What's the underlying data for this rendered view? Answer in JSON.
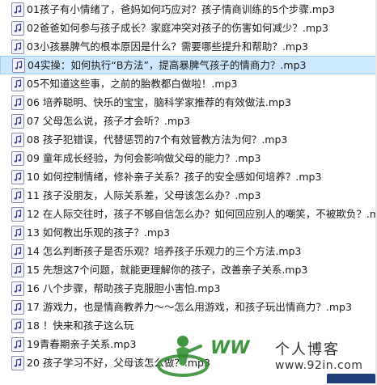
{
  "files": [
    {
      "name": "01孩子有小情绪了，爸妈如何巧应对？孩子情商训练的5个步骤.mp3",
      "selected": false
    },
    {
      "name": "02爸爸如何参与孩子成长？家庭冲突对孩子的伤害如何减少？.mp3",
      "selected": false
    },
    {
      "name": "03小孩暴脾气的根本原因是什么？需要哪些提升和帮助？.mp3",
      "selected": false
    },
    {
      "name": "04实操：如何执行“B方法”，提高暴脾气孩子的情商力？.mp3",
      "selected": true
    },
    {
      "name": "05不知道这些事，之前的胎教都白做啦！.mp3",
      "selected": false
    },
    {
      "name": "06 培养聪明、快乐的宝宝，脑科学家推荐的有效做法.mp3",
      "selected": false
    },
    {
      "name": "07 父母怎么说，孩子才会听？.mp3",
      "selected": false
    },
    {
      "name": "08 孩子犯错误，代替惩罚的7个有效管教方法为何？.mp3",
      "selected": false
    },
    {
      "name": "09 童年成长经验，为何会影响做父母的能力？.mp3",
      "selected": false
    },
    {
      "name": "10 如何控制情绪，修补亲子关系？孩子的安全感如何培养？.mp3",
      "selected": false
    },
    {
      "name": "11 孩子没朋友，人际关系差，父母该怎么办？.mp3",
      "selected": false
    },
    {
      "name": "12 在人际交往时，孩子不够自信怎么办？如何回应别人的嘲笑，不被欺负？.mp3",
      "selected": false
    },
    {
      "name": "13 如何教出乐观的孩子？.mp3",
      "selected": false
    },
    {
      "name": "14 怎么判断孩子是否乐观？培养孩子乐观力的三个方法.mp3",
      "selected": false
    },
    {
      "name": "15 先想这7个问题，就能更理解你的孩子，改善亲子关系.mp3",
      "selected": false
    },
    {
      "name": "16 八个步骤，帮助孩子克服胆小害怕.mp3",
      "selected": false
    },
    {
      "name": "17 游戏力，也是情商教养力～～怎么用游戏，和孩子玩出情商力？.mp3",
      "selected": false
    },
    {
      "name": "18 ！快来和孩子这么玩",
      "selected": false
    },
    {
      "name": "19青春期亲子关系.mp3",
      "selected": false
    },
    {
      "name": "20 孩子学习不好，父母该怎么做？.mp3",
      "selected": false
    }
  ],
  "watermark": {
    "brand": "WW",
    "site_name": "个人博客",
    "url": "www.92in.com"
  },
  "colors": {
    "selected_bg": "#cce8ff",
    "selected_border": "#99d1ff",
    "watermark_green": "#2a8a2a"
  },
  "icons": {
    "file": "music-file-icon"
  }
}
